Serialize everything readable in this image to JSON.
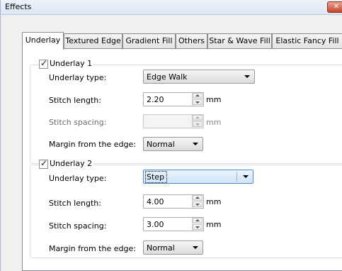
{
  "window": {
    "title": "Effects",
    "close_glyph": "✕"
  },
  "tabs": [
    {
      "label": "Underlay",
      "active": true
    },
    {
      "label": "Textured Edge"
    },
    {
      "label": "Gradient Fill"
    },
    {
      "label": "Others"
    },
    {
      "label": "Star & Wave Fill"
    },
    {
      "label": "Elastic Fancy Fill"
    }
  ],
  "underlay1": {
    "checkbox_label": "Underlay 1",
    "checked": true,
    "type_label": "Underlay type:",
    "type_value": "Edge Walk",
    "stitch_length_label": "Stitch length:",
    "stitch_length_value": "2.20",
    "stitch_length_unit": "mm",
    "stitch_spacing_label": "Stitch spacing:",
    "stitch_spacing_value": "",
    "stitch_spacing_unit": "mm",
    "stitch_spacing_enabled": false,
    "margin_label": "Margin from the edge:",
    "margin_value": "Normal"
  },
  "underlay2": {
    "checkbox_label": "Underlay 2",
    "checked": true,
    "type_label": "Underlay type:",
    "type_value": "Step",
    "stitch_length_label": "Stitch length:",
    "stitch_length_value": "4.00",
    "stitch_length_unit": "mm",
    "stitch_spacing_label": "Stitch spacing:",
    "stitch_spacing_value": "3.00",
    "stitch_spacing_unit": "mm",
    "margin_label": "Margin from the edge:",
    "margin_value": "Normal"
  },
  "icons": {
    "check": "✓"
  }
}
